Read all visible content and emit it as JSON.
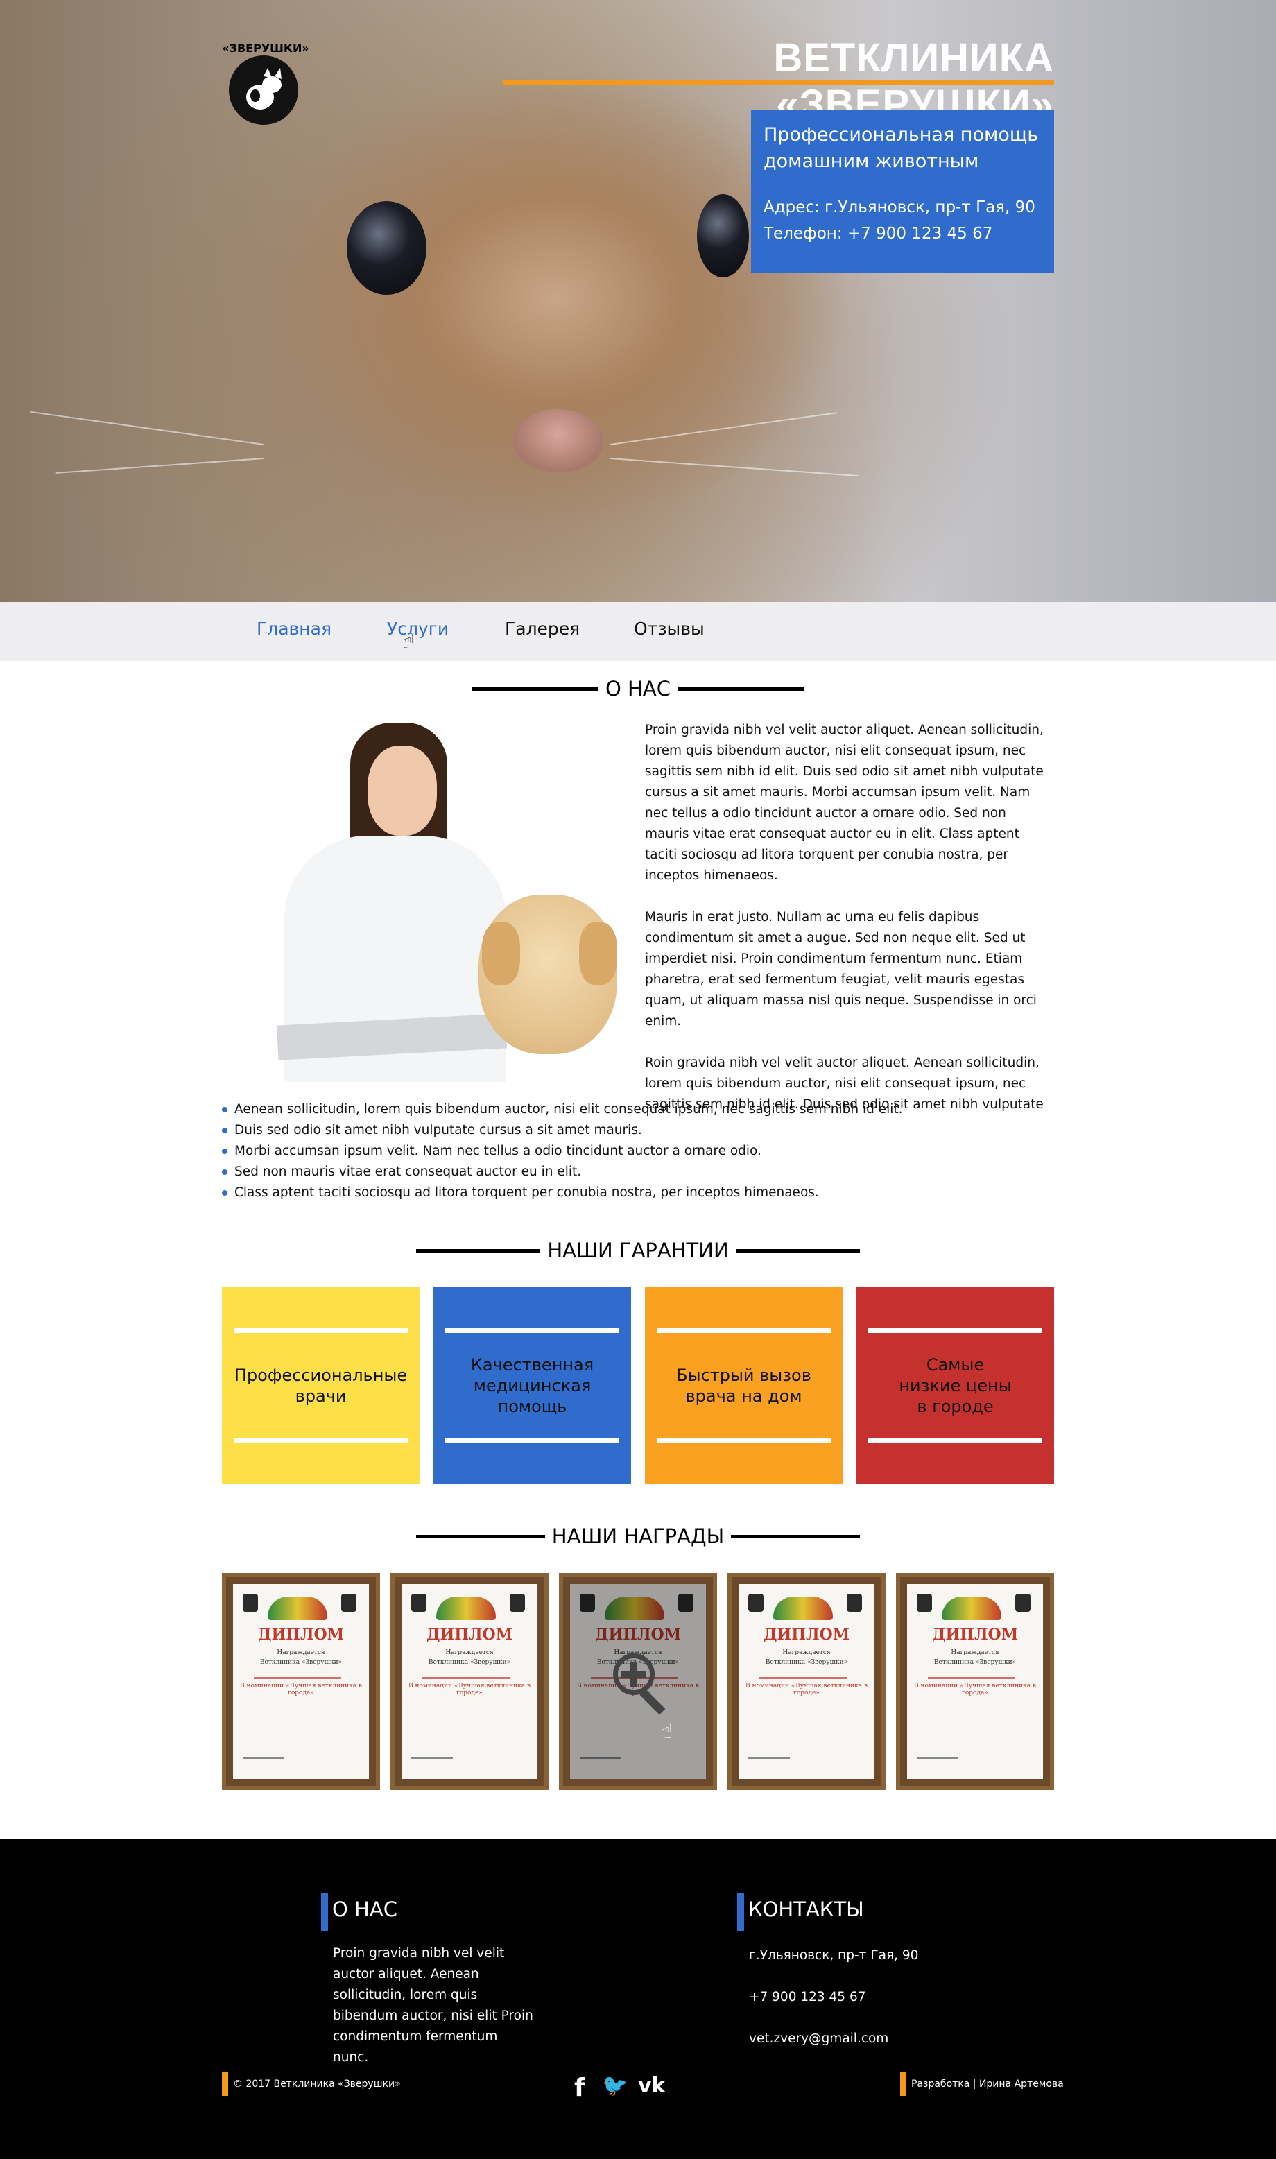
{
  "logo": {
    "text": "«ЗВЕРУШКИ»"
  },
  "header": {
    "title": "ВЕТКЛИНИКА «ЗВЕРУШКИ»",
    "tagline": "Профессиональная помощь домашним животным",
    "address": "Адрес: г.Ульяновск, пр-т Гая, 90",
    "phone": "Телефон: +7 900 123 45 67"
  },
  "nav": {
    "items": [
      {
        "label": "Главная"
      },
      {
        "label": "Услуги"
      },
      {
        "label": "Галерея"
      },
      {
        "label": "Отзывы"
      }
    ]
  },
  "about": {
    "heading": "О НАС",
    "paragraphs": [
      "Proin gravida nibh vel velit auctor aliquet. Aenean sollicitudin, lorem quis bibendum auctor, nisi elit consequat ipsum, nec sagittis sem nibh id elit. Duis sed odio sit amet nibh vulputate cursus a sit amet mauris. Morbi accumsan ipsum velit. Nam nec tellus a odio tincidunt auctor a ornare odio. Sed non  mauris vitae erat consequat auctor eu in elit. Class aptent taciti sociosqu ad litora torquent per conubia nostra, per inceptos himenaeos.",
      "Mauris in erat justo. Nullam ac urna eu felis dapibus condimentum sit amet a augue. Sed non neque elit. Sed ut imperdiet nisi. Proin condimentum fermentum nunc. Etiam pharetra, erat sed fermentum feugiat, velit mauris egestas quam, ut aliquam massa nisl quis neque. Suspendisse in orci enim.",
      "Roin gravida nibh vel velit auctor aliquet. Aenean sollicitudin, lorem quis bibendum auctor, nisi elit consequat ipsum, nec sagittis sem nibh id elit. Duis sed odio sit amet nibh vulputate cursus a sit"
    ],
    "bullets": [
      "Aenean sollicitudin, lorem quis bibendum auctor, nisi elit consequat ipsum, nec sagittis sem nibh id elit.",
      "Duis sed odio sit amet nibh vulputate cursus a sit amet mauris.",
      "Morbi accumsan ipsum velit. Nam nec tellus a odio tincidunt auctor a ornare odio.",
      "Sed non  mauris vitae erat consequat auctor eu in elit.",
      "Class aptent taciti sociosqu ad litora torquent per conubia nostra, per inceptos himenaeos."
    ]
  },
  "guarantees": {
    "heading": "НАШИ ГАРАНТИИ",
    "cards": [
      {
        "text": "Профессиональные\nврачи",
        "color": "#fde047"
      },
      {
        "text": "Качественная\nмедицинская\nпомощь",
        "color": "#2f6ccc"
      },
      {
        "text": "Быстрый вызов\nврача на дом",
        "color": "#fba121"
      },
      {
        "text": "Самые\nнизкие цены\nв городе",
        "color": "#c5312f"
      }
    ]
  },
  "awards": {
    "heading": "НАШИ НАГРАДЫ",
    "diploma_title": "ДИПЛОМ",
    "diploma_line1": "Награждается",
    "diploma_line2": "Ветклиника «Зверушки»",
    "diploma_line3": "В номинации «Лучшая ветклиника в городе»",
    "count": 5
  },
  "footer": {
    "about_heading": "О НАС",
    "about_text": "Proin gravida nibh vel velit auctor aliquet. Aenean sollicitudin, lorem quis bibendum auctor, nisi elit Proin condimentum fermentum nunc.",
    "contacts_heading": "КОНТАКТЫ",
    "address": "г.Ульяновск, пр-т Гая, 90",
    "phone": "+7 900 123 45 67",
    "email": "vet.zvery@gmail.com",
    "copyright": "© 2017 Ветклиника «Зверушки»",
    "developer": "Разработка | Ирина Артемова",
    "social": [
      {
        "icon": "facebook-icon",
        "glyph": "f"
      },
      {
        "icon": "twitter-icon",
        "glyph": "🐦"
      },
      {
        "icon": "vk-icon",
        "glyph": "vk"
      }
    ]
  },
  "colors": {
    "accent_blue": "#2f6ccc",
    "accent_orange": "#f39a1e"
  }
}
